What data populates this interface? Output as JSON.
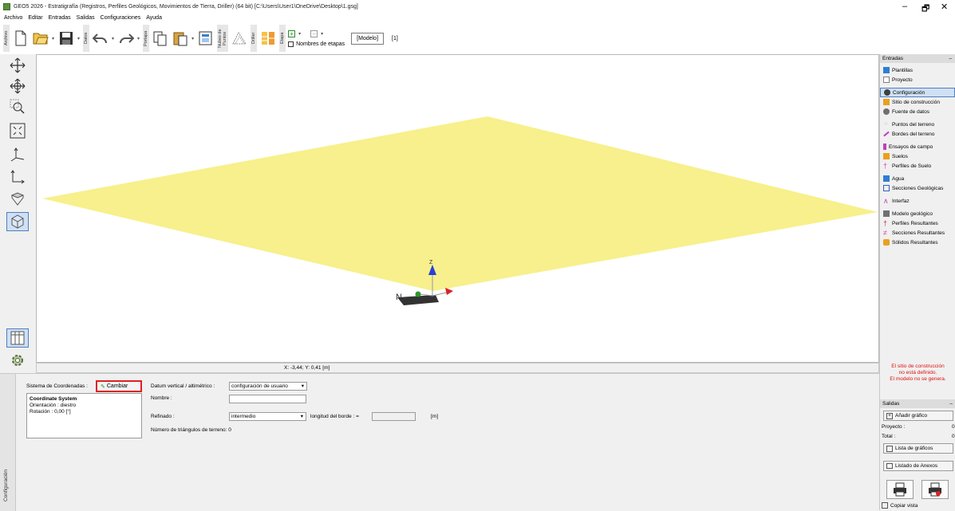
{
  "window": {
    "title": "GEO5 2026 - Estratigrafía (Registros, Perfiles Geológicos, Movimientos de Tierra, Driller) (64 bit) [C:\\Users\\User1\\OneDrive\\Desktop\\1.gsg]",
    "minimize": "‒",
    "restore": "🗗",
    "close": "✕"
  },
  "menu": [
    "Archivo",
    "Editar",
    "Entradas",
    "Salidas",
    "Configuraciones",
    "Ayuda"
  ],
  "toolbar": {
    "group_labels": [
      "Archivo",
      "Datos",
      "Portapa",
      "Nubes de Puntos",
      "Driller",
      "Etapa"
    ],
    "stage_names_label": "Nombres de etapas",
    "modelo_button": "[Modelo]",
    "stage_number": "[1]"
  },
  "status": {
    "coordinates": "X: -3,44; Y: 0,41 [m]"
  },
  "axes": {
    "z": "Z",
    "n": "N"
  },
  "bottom": {
    "side_tab": "Configuración",
    "coord_system_label": "Sistema de Coordenadas :",
    "cambiar_label": "Cambiar",
    "cs_title": "Coordinate System",
    "cs_orientation": "Orientación : diestro",
    "cs_rotation": "Rotación : 0,00 [°]",
    "datum_label": "Datum vertical / altimétrico :",
    "datum_value": "configuración de usuario",
    "nombre_label": "Nombre :",
    "nombre_value": "",
    "refinado_label": "Refinado :",
    "refinado_value": "intermedio",
    "longitud_label": "longitud del borde : =",
    "longitud_value": "",
    "longitud_unit": "[m]",
    "triangles": "Número de triángulos de terreno: 0"
  },
  "right": {
    "entradas_header": "Entradas",
    "items": [
      {
        "label": "Plantillas",
        "color": "#2f7fd0"
      },
      {
        "label": "Proyecto",
        "color": "#808080"
      },
      {
        "label": "Configuración",
        "color": "#404040",
        "selected": true
      },
      {
        "label": "Sitio de construcción",
        "color": "#e8a020"
      },
      {
        "label": "Fuente de datos",
        "color": "#707070"
      },
      {
        "label": "Puntos del terreno",
        "color": "#b0b0b0"
      },
      {
        "label": "Bordes del terreno",
        "color": "#c040c0"
      },
      {
        "label": "Ensayos de campo",
        "color": "#c040c0"
      },
      {
        "label": "Suelos",
        "color": "#e8a020"
      },
      {
        "label": "Perfiles de Suelo",
        "color": "#e040a0"
      },
      {
        "label": "Agua",
        "color": "#2f7fd0"
      },
      {
        "label": "Secciones Geológicas",
        "color": "#3060c0"
      },
      {
        "label": "Interfaz",
        "color": "#c040c0"
      },
      {
        "label": "Modelo geológico",
        "color": "#707070"
      },
      {
        "label": "Perfiles Resultantes",
        "color": "#c04040"
      },
      {
        "label": "Secciones Resultantes",
        "color": "#e040a0"
      },
      {
        "label": "Sólidos Resultantes",
        "color": "#e8a020"
      }
    ],
    "warning_line1": "El sitio de construcción",
    "warning_line2": "no está definido.",
    "warning_line3": "El modelo no se genera.",
    "salidas_header": "Salidas",
    "add_chart": "Añadir gráfico",
    "proyecto_label": "Proyecto :",
    "proyecto_value": "0",
    "total_label": "Total :",
    "total_value": "0",
    "chart_list": "Lista de gráficos",
    "annex_list": "Listado de Anexos",
    "copy_view": "Copiar vista"
  },
  "colors": {
    "terrain": "#f7f08c",
    "accent": "#4f7fbf",
    "warning": "#e01010",
    "highlight_border": "#e02020"
  }
}
